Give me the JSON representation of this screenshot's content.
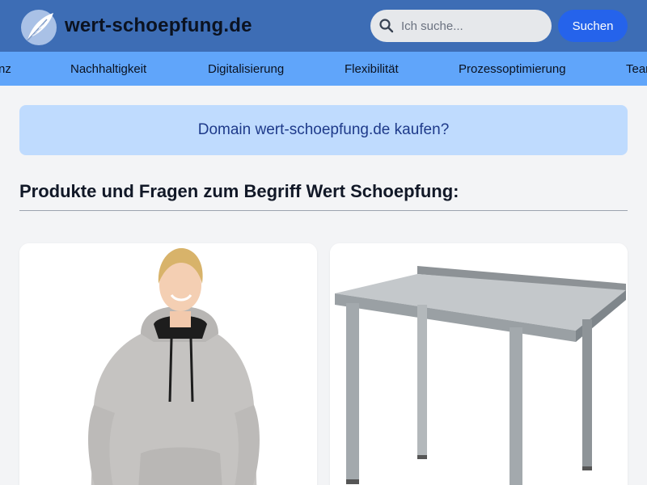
{
  "header": {
    "site_title": "wert-schoepfung.de",
    "search": {
      "placeholder": "Ich suche...",
      "button_label": "Suchen"
    }
  },
  "nav": {
    "items": [
      "nz",
      "Nachhaltigkeit",
      "Digitalisierung",
      "Flexibilität",
      "Prozessoptimierung",
      "Tean"
    ]
  },
  "banner": {
    "text": "Domain wert-schoepfung.de kaufen?"
  },
  "section": {
    "title": "Produkte und Fragen zum Begriff Wert Schoepfung:"
  },
  "products": [
    {
      "image": "hoodie-woman-photo"
    },
    {
      "image": "stainless-steel-table-photo"
    }
  ],
  "colors": {
    "header_bg": "#3d6db5",
    "nav_bg": "#60a5fa",
    "button": "#2563eb",
    "banner_bg": "#bfdbfe",
    "banner_text": "#1e3a8a"
  }
}
